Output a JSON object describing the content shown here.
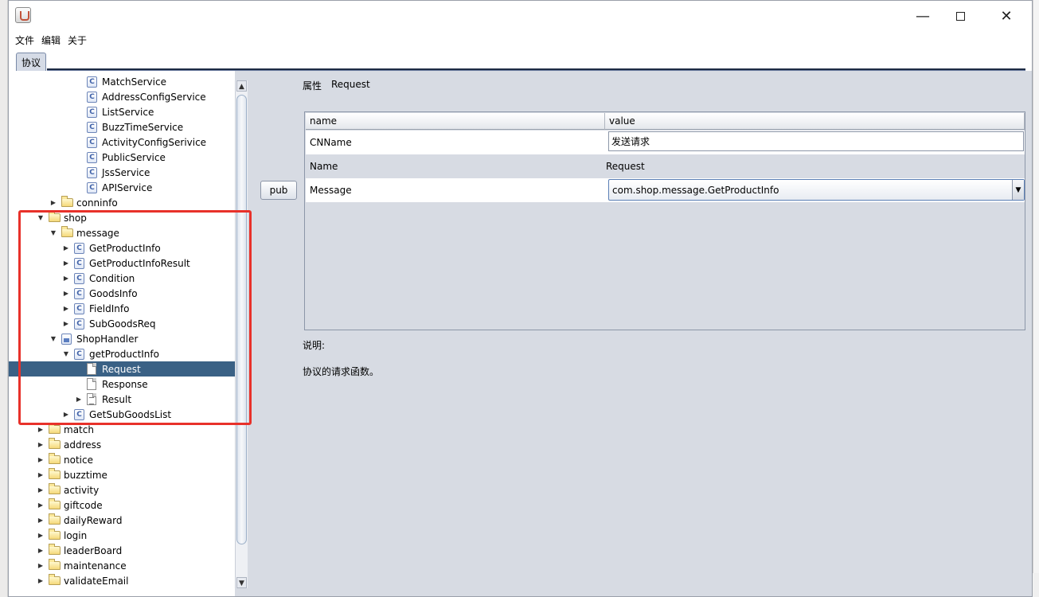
{
  "window": {
    "minimize_icon": "minimize-icon",
    "maximize_icon": "maximize-icon",
    "close_icon": "close-icon"
  },
  "menu": [
    "文件",
    "编辑",
    "关于"
  ],
  "tabs": [
    {
      "label": "协议",
      "active": true
    }
  ],
  "tree": [
    {
      "label": "MatchService",
      "icon": "class",
      "indent": 4,
      "toggle": ""
    },
    {
      "label": "AddressConfigService",
      "icon": "class",
      "indent": 4,
      "toggle": ""
    },
    {
      "label": "ListService",
      "icon": "class",
      "indent": 4,
      "toggle": ""
    },
    {
      "label": "BuzzTimeService",
      "icon": "class",
      "indent": 4,
      "toggle": ""
    },
    {
      "label": "ActivityConfigSerivice",
      "icon": "class",
      "indent": 4,
      "toggle": ""
    },
    {
      "label": "PublicService",
      "icon": "class",
      "indent": 4,
      "toggle": ""
    },
    {
      "label": "JssService",
      "icon": "class",
      "indent": 4,
      "toggle": ""
    },
    {
      "label": "APIService",
      "icon": "class",
      "indent": 4,
      "toggle": ""
    },
    {
      "label": "conninfo",
      "icon": "folder",
      "indent": 2,
      "toggle": "collapsed"
    },
    {
      "label": "shop",
      "icon": "folder",
      "indent": 1,
      "toggle": "expanded"
    },
    {
      "label": "message",
      "icon": "folder",
      "indent": 2,
      "toggle": "expanded"
    },
    {
      "label": "GetProductInfo",
      "icon": "class",
      "indent": 3,
      "toggle": "collapsed"
    },
    {
      "label": "GetProductInfoResult",
      "icon": "class",
      "indent": 3,
      "toggle": "collapsed"
    },
    {
      "label": "Condition",
      "icon": "class",
      "indent": 3,
      "toggle": "collapsed"
    },
    {
      "label": "GoodsInfo",
      "icon": "class",
      "indent": 3,
      "toggle": "collapsed"
    },
    {
      "label": "FieldInfo",
      "icon": "class",
      "indent": 3,
      "toggle": "collapsed"
    },
    {
      "label": "SubGoodsReq",
      "icon": "class",
      "indent": 3,
      "toggle": "collapsed"
    },
    {
      "label": "ShopHandler",
      "icon": "interface",
      "indent": 2,
      "toggle": "expanded"
    },
    {
      "label": "getProductInfo",
      "icon": "class",
      "indent": 3,
      "toggle": "expanded"
    },
    {
      "label": "Request",
      "icon": "file",
      "indent": 4,
      "toggle": "",
      "selected": true
    },
    {
      "label": "Response",
      "icon": "file",
      "indent": 4,
      "toggle": ""
    },
    {
      "label": "Result",
      "icon": "file-lines",
      "indent": 4,
      "toggle": "collapsed"
    },
    {
      "label": "GetSubGoodsList",
      "icon": "class",
      "indent": 3,
      "toggle": "collapsed"
    },
    {
      "label": "match",
      "icon": "folder",
      "indent": 1,
      "toggle": "collapsed"
    },
    {
      "label": "address",
      "icon": "folder",
      "indent": 1,
      "toggle": "collapsed"
    },
    {
      "label": "notice",
      "icon": "folder",
      "indent": 1,
      "toggle": "collapsed"
    },
    {
      "label": "buzztime",
      "icon": "folder",
      "indent": 1,
      "toggle": "collapsed"
    },
    {
      "label": "activity",
      "icon": "folder",
      "indent": 1,
      "toggle": "collapsed"
    },
    {
      "label": "giftcode",
      "icon": "folder",
      "indent": 1,
      "toggle": "collapsed"
    },
    {
      "label": "dailyReward",
      "icon": "folder",
      "indent": 1,
      "toggle": "collapsed"
    },
    {
      "label": "login",
      "icon": "folder",
      "indent": 1,
      "toggle": "collapsed"
    },
    {
      "label": "leaderBoard",
      "icon": "folder",
      "indent": 1,
      "toggle": "collapsed"
    },
    {
      "label": "maintenance",
      "icon": "folder",
      "indent": 1,
      "toggle": "collapsed"
    },
    {
      "label": "validateEmail",
      "icon": "folder",
      "indent": 1,
      "toggle": "collapsed"
    }
  ],
  "pub_button": "pub",
  "attributes": {
    "title": "属性",
    "value": "Request",
    "columns": [
      "name",
      "value"
    ],
    "rows": [
      {
        "name": "CNName",
        "value": "发送请求",
        "editor": "text"
      },
      {
        "name": "Name",
        "value": "Request",
        "editor": "none"
      },
      {
        "name": "Message",
        "value": "com.shop.message.GetProductInfo",
        "editor": "select"
      }
    ]
  },
  "description": {
    "title": "说明:",
    "text": "协议的请求函数。"
  },
  "colors": {
    "selection": "#3a6185",
    "highlight_box": "#e8312a",
    "panel_bg": "#d7dbe3"
  }
}
